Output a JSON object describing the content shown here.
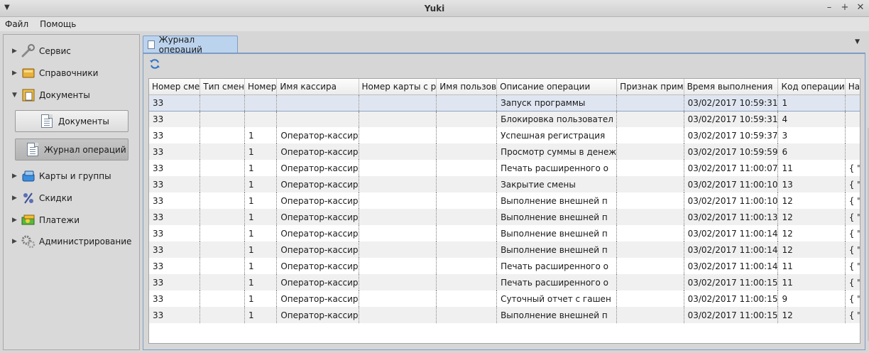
{
  "window": {
    "title": "Yuki",
    "menu_glyph": "▼",
    "controls": [
      "–",
      "+",
      "✕"
    ]
  },
  "menubar": [
    "Файл",
    "Помощь"
  ],
  "sidebar": {
    "items": [
      {
        "label": "Сервис",
        "arrow": "▶",
        "icon": "wrench-icon"
      },
      {
        "label": "Справочники",
        "arrow": "▶",
        "icon": "book-icon"
      },
      {
        "label": "Документы",
        "arrow": "▼",
        "icon": "folder-documents-icon"
      },
      {
        "label": "Карты и группы",
        "arrow": "▶",
        "icon": "cards-icon"
      },
      {
        "label": "Скидки",
        "arrow": "▶",
        "icon": "percent-icon"
      },
      {
        "label": "Платежи",
        "arrow": "▶",
        "icon": "money-icon"
      },
      {
        "label": "Администрирование",
        "arrow": "▶",
        "icon": "gears-icon"
      }
    ],
    "sub_buttons": [
      {
        "label": "Документы",
        "active": false
      },
      {
        "label": "Журнал операций",
        "active": true
      }
    ]
  },
  "tabs": [
    {
      "label": "Журнал операций",
      "active": true
    }
  ],
  "table": {
    "columns": [
      "Номер сме",
      "Тип смен",
      "Номер",
      "Имя кассира",
      "Номер карты с р",
      "Имя пользов",
      "Описание операции",
      "Признак прим",
      "Время выполнения",
      "Код операции",
      "Назв"
    ],
    "rows": [
      [
        "33",
        "",
        "",
        "",
        "",
        "",
        "Запуск программы",
        "",
        "03/02/2017 10:59:31",
        "1",
        ""
      ],
      [
        "33",
        "",
        "",
        "",
        "",
        "",
        "Блокировка пользовател",
        "",
        "03/02/2017 10:59:31",
        "4",
        ""
      ],
      [
        "33",
        "",
        "1",
        "Оператор-кассир",
        "",
        "",
        "Успешная регистрация",
        "",
        "03/02/2017 10:59:37",
        "3",
        ""
      ],
      [
        "33",
        "",
        "1",
        "Оператор-кассир",
        "",
        "",
        "Просмотр суммы в денеж",
        "",
        "03/02/2017 10:59:59",
        "6",
        ""
      ],
      [
        "33",
        "",
        "1",
        "Оператор-кассир",
        "",
        "",
        "Печать расширенного о",
        "",
        "03/02/2017 11:00:07",
        "11",
        "{ \"repo"
      ],
      [
        "33",
        "",
        "1",
        "Оператор-кассир",
        "",
        "",
        "Закрытие смены",
        "",
        "03/02/2017 11:00:10",
        "13",
        "{ \"sum"
      ],
      [
        "33",
        "",
        "1",
        "Оператор-кассир",
        "",
        "",
        "Выполнение внешней п",
        "",
        "03/02/2017 11:00:10",
        "12",
        "{ \"com"
      ],
      [
        "33",
        "",
        "1",
        "Оператор-кассир",
        "",
        "",
        "Выполнение внешней п",
        "",
        "03/02/2017 11:00:13",
        "12",
        "{ \"com"
      ],
      [
        "33",
        "",
        "1",
        "Оператор-кассир",
        "",
        "",
        "Выполнение внешней п",
        "",
        "03/02/2017 11:00:14",
        "12",
        "{ \"com"
      ],
      [
        "33",
        "",
        "1",
        "Оператор-кассир",
        "",
        "",
        "Выполнение внешней п",
        "",
        "03/02/2017 11:00:14",
        "12",
        "{ \"com"
      ],
      [
        "33",
        "",
        "1",
        "Оператор-кассир",
        "",
        "",
        "Печать расширенного о",
        "",
        "03/02/2017 11:00:14",
        "11",
        "{ \"repo"
      ],
      [
        "33",
        "",
        "1",
        "Оператор-кассир",
        "",
        "",
        "Печать расширенного о",
        "",
        "03/02/2017 11:00:15",
        "11",
        "{ \"repo"
      ],
      [
        "33",
        "",
        "1",
        "Оператор-кассир",
        "",
        "",
        "Суточный отчет с гашен",
        "",
        "03/02/2017 11:00:15",
        "9",
        "{ \"com"
      ],
      [
        "33",
        "",
        "1",
        "Оператор-кассир",
        "",
        "",
        "Выполнение внешней п",
        "",
        "03/02/2017 11:00:15",
        "12",
        "{ \"com"
      ]
    ],
    "selected_row": 0
  },
  "colors": {
    "tab_active": "#bcd3ee",
    "selection": "#dfe6f1",
    "frame_border": "#7e9cc4"
  }
}
